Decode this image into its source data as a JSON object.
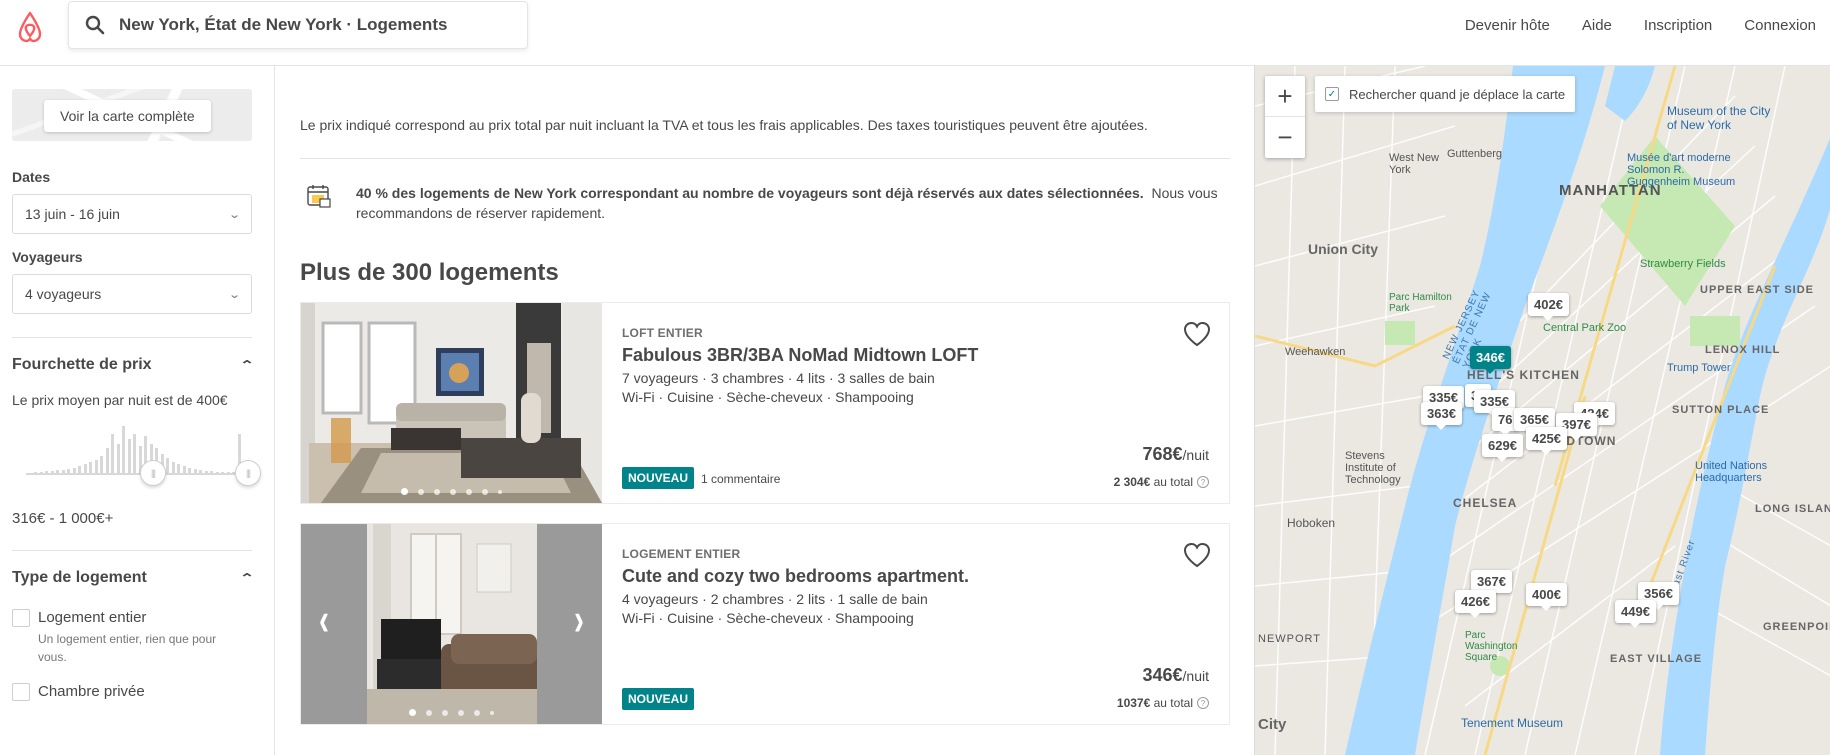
{
  "header": {
    "search_text": "New York, État de New York · Logements",
    "nav": [
      "Devenir hôte",
      "Aide",
      "Inscription",
      "Connexion"
    ]
  },
  "sidebar": {
    "map_button": "Voir la carte complète",
    "dates_label": "Dates",
    "dates_value": "13 juin - 16 juin",
    "guests_label": "Voyageurs",
    "guests_value": "4 voyageurs",
    "price_section": "Fourchette de prix",
    "price_avg": "Le prix moyen par nuit est de 400€",
    "price_range": "316€ - 1 000€+",
    "type_section": "Type de logement",
    "types": [
      {
        "title": "Logement entier",
        "desc": "Un logement entier, rien que pour vous."
      },
      {
        "title": "Chambre privée",
        "desc": ""
      }
    ]
  },
  "main": {
    "disclaimer": "Le prix indiqué correspond au prix total par nuit incluant la TVA et tous les frais applicables. Des taxes touristiques peuvent être ajoutées.",
    "notice_bold": "40 % des logements de New York correspondant au nombre de voyageurs sont déjà réservés aux dates sélectionnées.",
    "notice_rest": "Nous vous recommandons de réserver rapidement.",
    "heading": "Plus de 300 logements",
    "listings": [
      {
        "type": "LOFT ENTIER",
        "title": "Fabulous 3BR/3BA NoMad Midtown LOFT",
        "details": "7 voyageurs · 3 chambres · 4 lits · 3 salles de bain",
        "amenities": "Wi-Fi · Cuisine · Sèche-cheveux · Shampooing",
        "badge": "NOUVEAU",
        "reviews": "1 commentaire",
        "price": "768€",
        "per_night": "/nuit",
        "total": "2 304€",
        "total_label": "au total"
      },
      {
        "type": "LOGEMENT ENTIER",
        "title": "Cute and cozy two bedrooms apartment.",
        "details": "4 voyageurs · 2 chambres · 2 lits · 1 salle de bain",
        "amenities": "Wi-Fi · Cuisine · Sèche-cheveux · Shampooing",
        "badge": "NOUVEAU",
        "reviews": "",
        "price": "346€",
        "per_night": "/nuit",
        "total": "1037€",
        "total_label": "au total"
      }
    ]
  },
  "map": {
    "search_toggle": "Rechercher quand je déplace la carte",
    "zoom_in": "+",
    "zoom_out": "−",
    "pins": [
      "402€",
      "346€",
      "335€",
      "33",
      "335€",
      "363€",
      "76",
      "365€",
      "424€",
      "397€",
      "629€",
      "425€",
      "367€",
      "400€",
      "356€",
      "426€",
      "449€"
    ],
    "labels": {
      "manhattan": "MANHATTAN",
      "union_city": "Union City",
      "hells_kitchen": "HELL'S KITCHEN",
      "midtown": "MIDTOWN",
      "chelsea": "CHELSEA",
      "hoboken": "Hoboken",
      "upper_east_side": "UPPER EAST SIDE",
      "lenox_hill": "LENOX HILL",
      "sutton_place": "SUTTON PLACE",
      "long_island_city": "LONG ISLAND CITY",
      "east_village": "EAST VILLAGE",
      "greenpoint": "GREENPOINT",
      "weehawken": "Weehawken",
      "west_new_york": "West New York",
      "guttenberg": "Guttenberg",
      "newport": "NEWPORT",
      "city": "City",
      "stevens": "Stevens Institute of Technology",
      "central_park_zoo": "Central Park Zoo",
      "strawberry_fields": "Strawberry Fields",
      "trump_tower": "Trump Tower",
      "un_hq": "United Nations Headquarters",
      "moma_nyc": "Museum of the City of New York",
      "moma": "Musée d'art moderne Solomon R. Guggenheim Museum",
      "tenement": "Tenement Museum",
      "parc_hamilton": "Parc Hamilton Park",
      "parc_washington": "Parc Washington Square",
      "east_river": "East River",
      "new_jersey": "NEW JERSEY ÉTAT DE NEW YORK"
    }
  }
}
